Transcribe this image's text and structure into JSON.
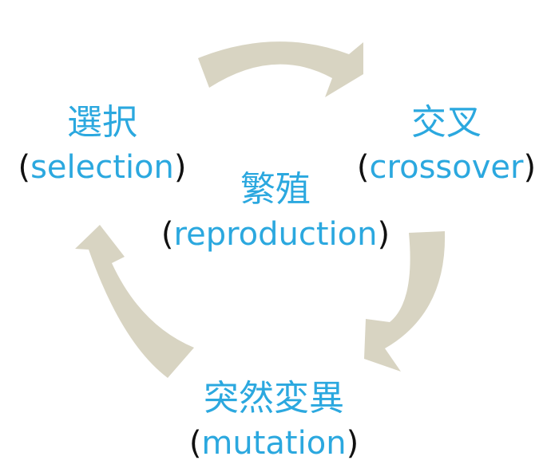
{
  "colors": {
    "text_accent": "#2BA8DF",
    "paren": "#111111",
    "arrow": "#D8D4C2"
  },
  "nodes": {
    "selection": {
      "jp": "選択",
      "en": "selection"
    },
    "crossover": {
      "jp": "交叉",
      "en": "crossover"
    },
    "reproduction": {
      "jp": "繁殖",
      "en": "reproduction"
    },
    "mutation": {
      "jp": "突然変異",
      "en": "mutation"
    }
  },
  "arrows": [
    {
      "from": "selection",
      "to": "crossover"
    },
    {
      "from": "crossover",
      "to": "mutation"
    },
    {
      "from": "mutation",
      "to": "selection"
    }
  ]
}
